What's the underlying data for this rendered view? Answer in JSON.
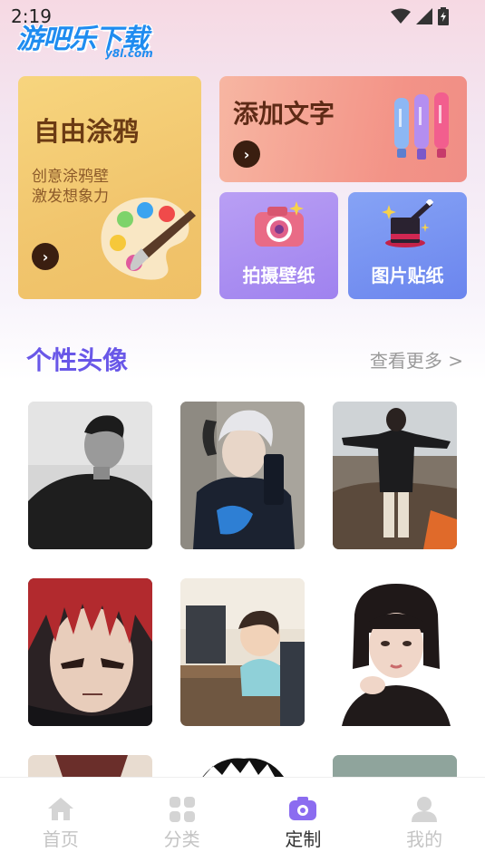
{
  "status_bar": {
    "time": "2:19"
  },
  "logo": {
    "main_text": "游吧乐下载",
    "sub_text": "y8l.com"
  },
  "features": {
    "graffiti": {
      "title": "自由涂鸦",
      "subtitle_line1": "创意涂鸦壁",
      "subtitle_line2": "激发想象力",
      "arrow": "›"
    },
    "add_text": {
      "title": "添加文字",
      "arrow": "›"
    },
    "photo_wallpaper": {
      "label": "拍摄壁纸"
    },
    "image_sticker": {
      "label": "图片贴纸"
    }
  },
  "avatars_section": {
    "title": "个性头像",
    "more": "查看更多 >"
  },
  "avatars": [
    "avatar-bw-man-jacket",
    "avatar-silver-hair-selfie",
    "avatar-hoodie-back-view",
    "avatar-anime-red-hair",
    "avatar-cartoon-boy-computer",
    "avatar-girl-bob-hair"
  ],
  "tabs": [
    {
      "label": "首页",
      "icon": "home-icon",
      "active": false
    },
    {
      "label": "分类",
      "icon": "grid-icon",
      "active": false
    },
    {
      "label": "定制",
      "icon": "camera-icon",
      "active": true
    },
    {
      "label": "我的",
      "icon": "user-icon",
      "active": false
    }
  ],
  "colors": {
    "accent": "#6957e8",
    "tab_active_icon": "#8b6cf0",
    "tab_inactive": "#c4c4c4"
  }
}
